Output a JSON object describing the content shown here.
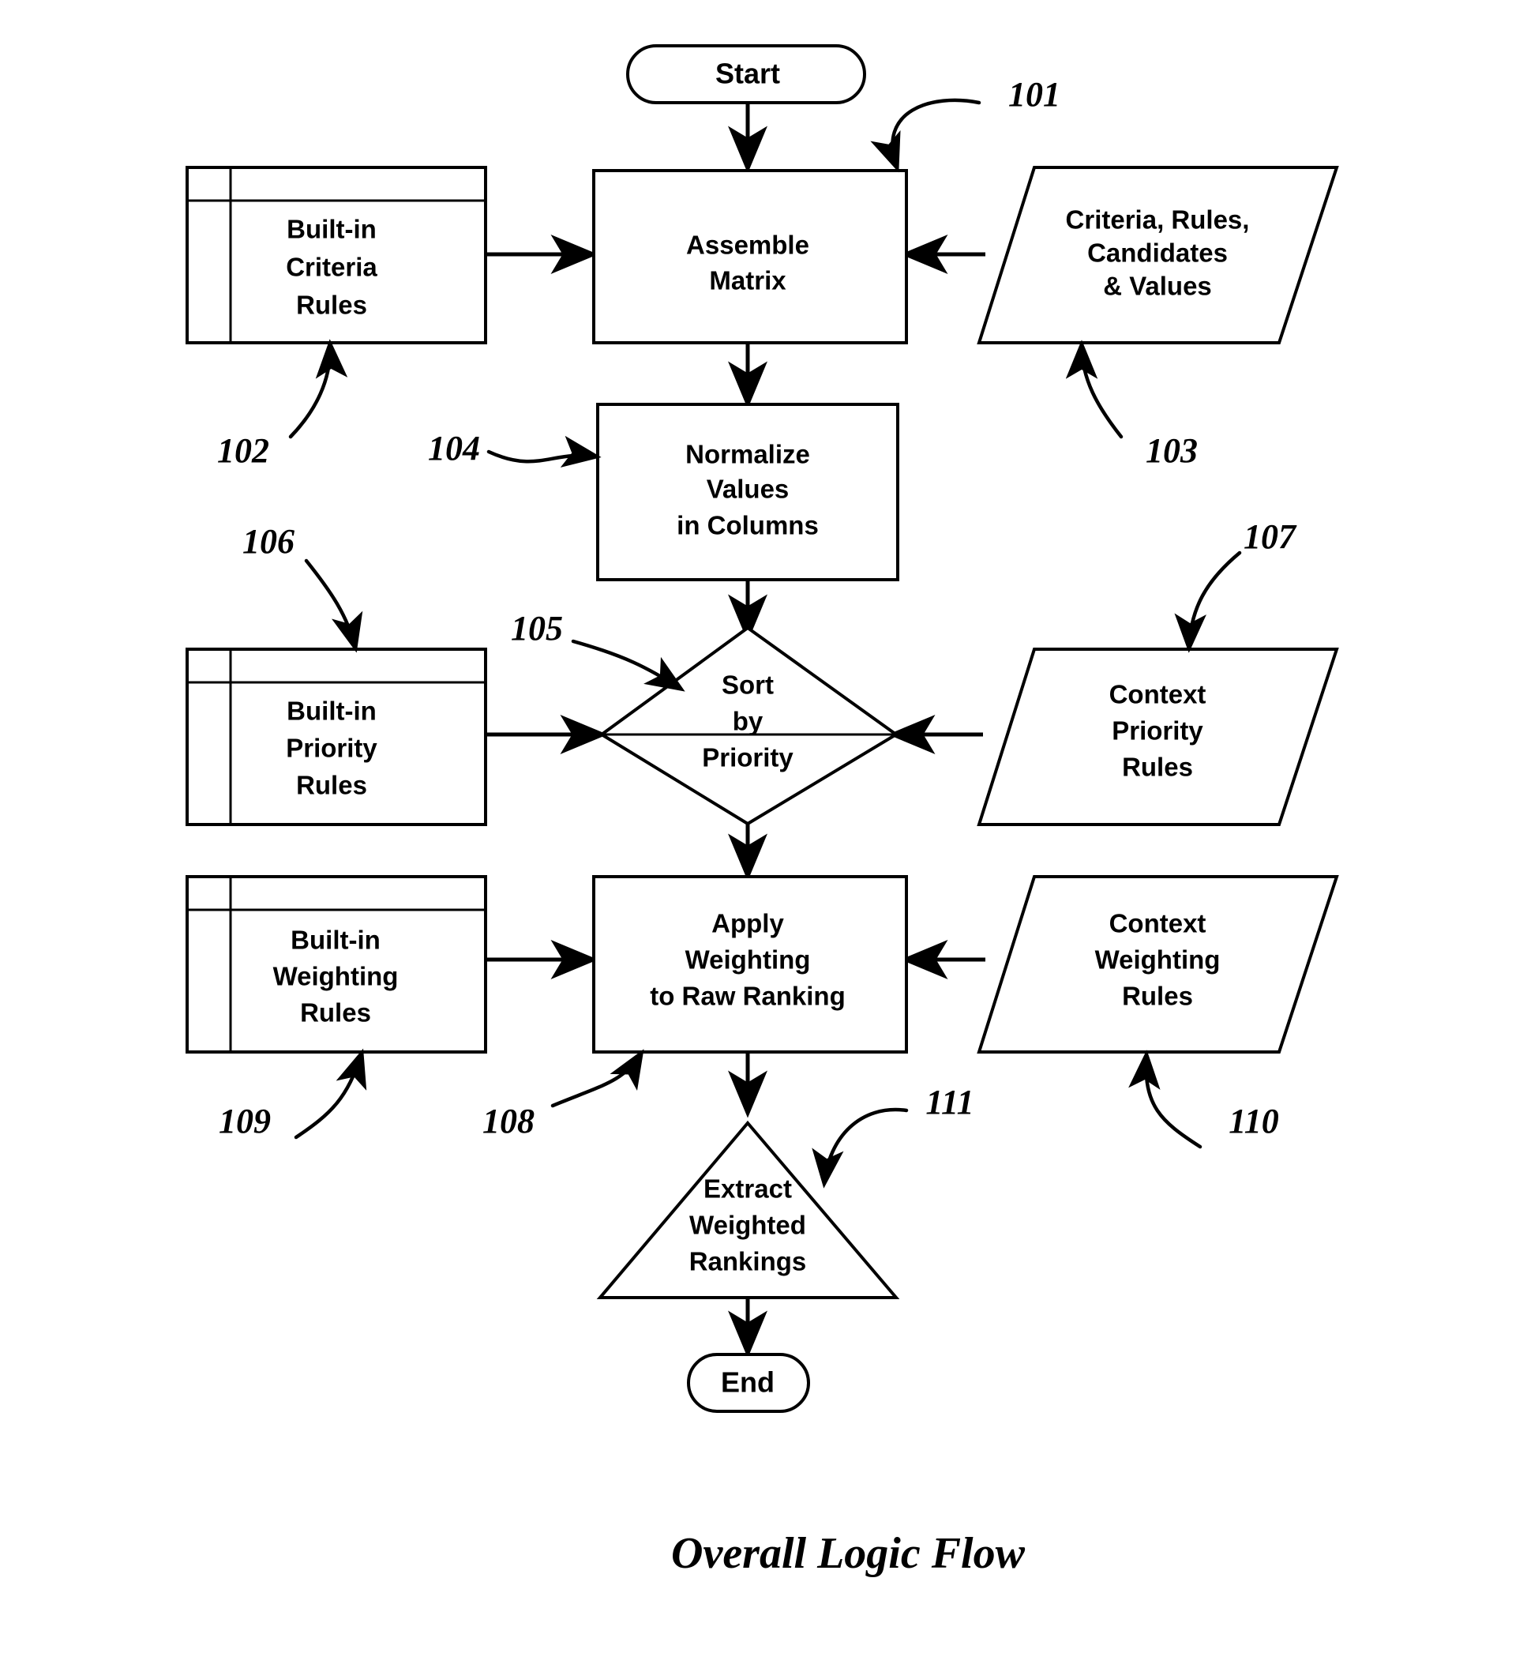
{
  "figure": {
    "caption": "Overall Logic Flow",
    "background_color": "#ffffff",
    "line_color": "#000000"
  },
  "nodes": {
    "start": {
      "label": "Start",
      "shape": "rounded-terminator"
    },
    "end": {
      "label": "End",
      "shape": "rounded-terminator"
    },
    "assemble_matrix": {
      "label_line1": "Assemble",
      "label_line2": "Matrix",
      "shape": "process-rectangle"
    },
    "normalize_values": {
      "label_line1": "Normalize",
      "label_line2": "Values",
      "label_line3": "in Columns",
      "shape": "process-rectangle"
    },
    "sort_by_priority": {
      "label_line1": "Sort",
      "label_line2": "by",
      "label_line3": "Priority",
      "shape": "decision-diamond"
    },
    "apply_weighting": {
      "label_line1": "Apply",
      "label_line2": "Weighting",
      "label_line3": "to Raw Ranking",
      "shape": "process-rectangle"
    },
    "extract_rankings": {
      "label_line1": "Extract",
      "label_line2": "Weighted",
      "label_line3": "Rankings",
      "shape": "triangle"
    },
    "builtin_criteria_rules": {
      "label_line1": "Built-in",
      "label_line2": "Criteria",
      "label_line3": "Rules",
      "shape": "table"
    },
    "builtin_priority_rules": {
      "label_line1": "Built-in",
      "label_line2": "Priority",
      "label_line3": "Rules",
      "shape": "table"
    },
    "builtin_weighting_rules": {
      "label_line1": "Built-in",
      "label_line2": "Weighting",
      "label_line3": "Rules",
      "shape": "table"
    },
    "criteria_rules_candidates_values": {
      "label_line1": "Criteria, Rules,",
      "label_line2": "Candidates",
      "label_line3": "& Values",
      "shape": "parallelogram"
    },
    "context_priority_rules": {
      "label_line1": "Context",
      "label_line2": "Priority",
      "label_line3": "Rules",
      "shape": "parallelogram"
    },
    "context_weighting_rules": {
      "label_line1": "Context",
      "label_line2": "Weighting",
      "label_line3": "Rules",
      "shape": "parallelogram"
    }
  },
  "reference_labels": [
    {
      "id": "ref-101",
      "text": "101",
      "points_to": "assemble_matrix"
    },
    {
      "id": "ref-102",
      "text": "102",
      "points_to": "builtin_criteria_rules"
    },
    {
      "id": "ref-103",
      "text": "103",
      "points_to": "criteria_rules_candidates_values"
    },
    {
      "id": "ref-104",
      "text": "104",
      "points_to": "normalize_values"
    },
    {
      "id": "ref-105",
      "text": "105",
      "points_to": "sort_by_priority"
    },
    {
      "id": "ref-106",
      "text": "106",
      "points_to": "builtin_priority_rules"
    },
    {
      "id": "ref-107",
      "text": "107",
      "points_to": "context_priority_rules"
    },
    {
      "id": "ref-108",
      "text": "108",
      "points_to": "apply_weighting"
    },
    {
      "id": "ref-109",
      "text": "109",
      "points_to": "builtin_weighting_rules"
    },
    {
      "id": "ref-110",
      "text": "110",
      "points_to": "context_weighting_rules"
    },
    {
      "id": "ref-111",
      "text": "111",
      "points_to": "extract_rankings"
    }
  ],
  "flow_edges": [
    {
      "from": "start",
      "to": "assemble_matrix",
      "direction": "down"
    },
    {
      "from": "builtin_criteria_rules",
      "to": "assemble_matrix",
      "direction": "right"
    },
    {
      "from": "criteria_rules_candidates_values",
      "to": "assemble_matrix",
      "direction": "left"
    },
    {
      "from": "assemble_matrix",
      "to": "normalize_values",
      "direction": "down"
    },
    {
      "from": "normalize_values",
      "to": "sort_by_priority",
      "direction": "down"
    },
    {
      "from": "builtin_priority_rules",
      "to": "sort_by_priority",
      "direction": "right"
    },
    {
      "from": "context_priority_rules",
      "to": "sort_by_priority",
      "direction": "left"
    },
    {
      "from": "sort_by_priority",
      "to": "apply_weighting",
      "direction": "down"
    },
    {
      "from": "builtin_weighting_rules",
      "to": "apply_weighting",
      "direction": "right"
    },
    {
      "from": "context_weighting_rules",
      "to": "apply_weighting",
      "direction": "left"
    },
    {
      "from": "apply_weighting",
      "to": "extract_rankings",
      "direction": "down"
    },
    {
      "from": "extract_rankings",
      "to": "end",
      "direction": "down"
    }
  ]
}
